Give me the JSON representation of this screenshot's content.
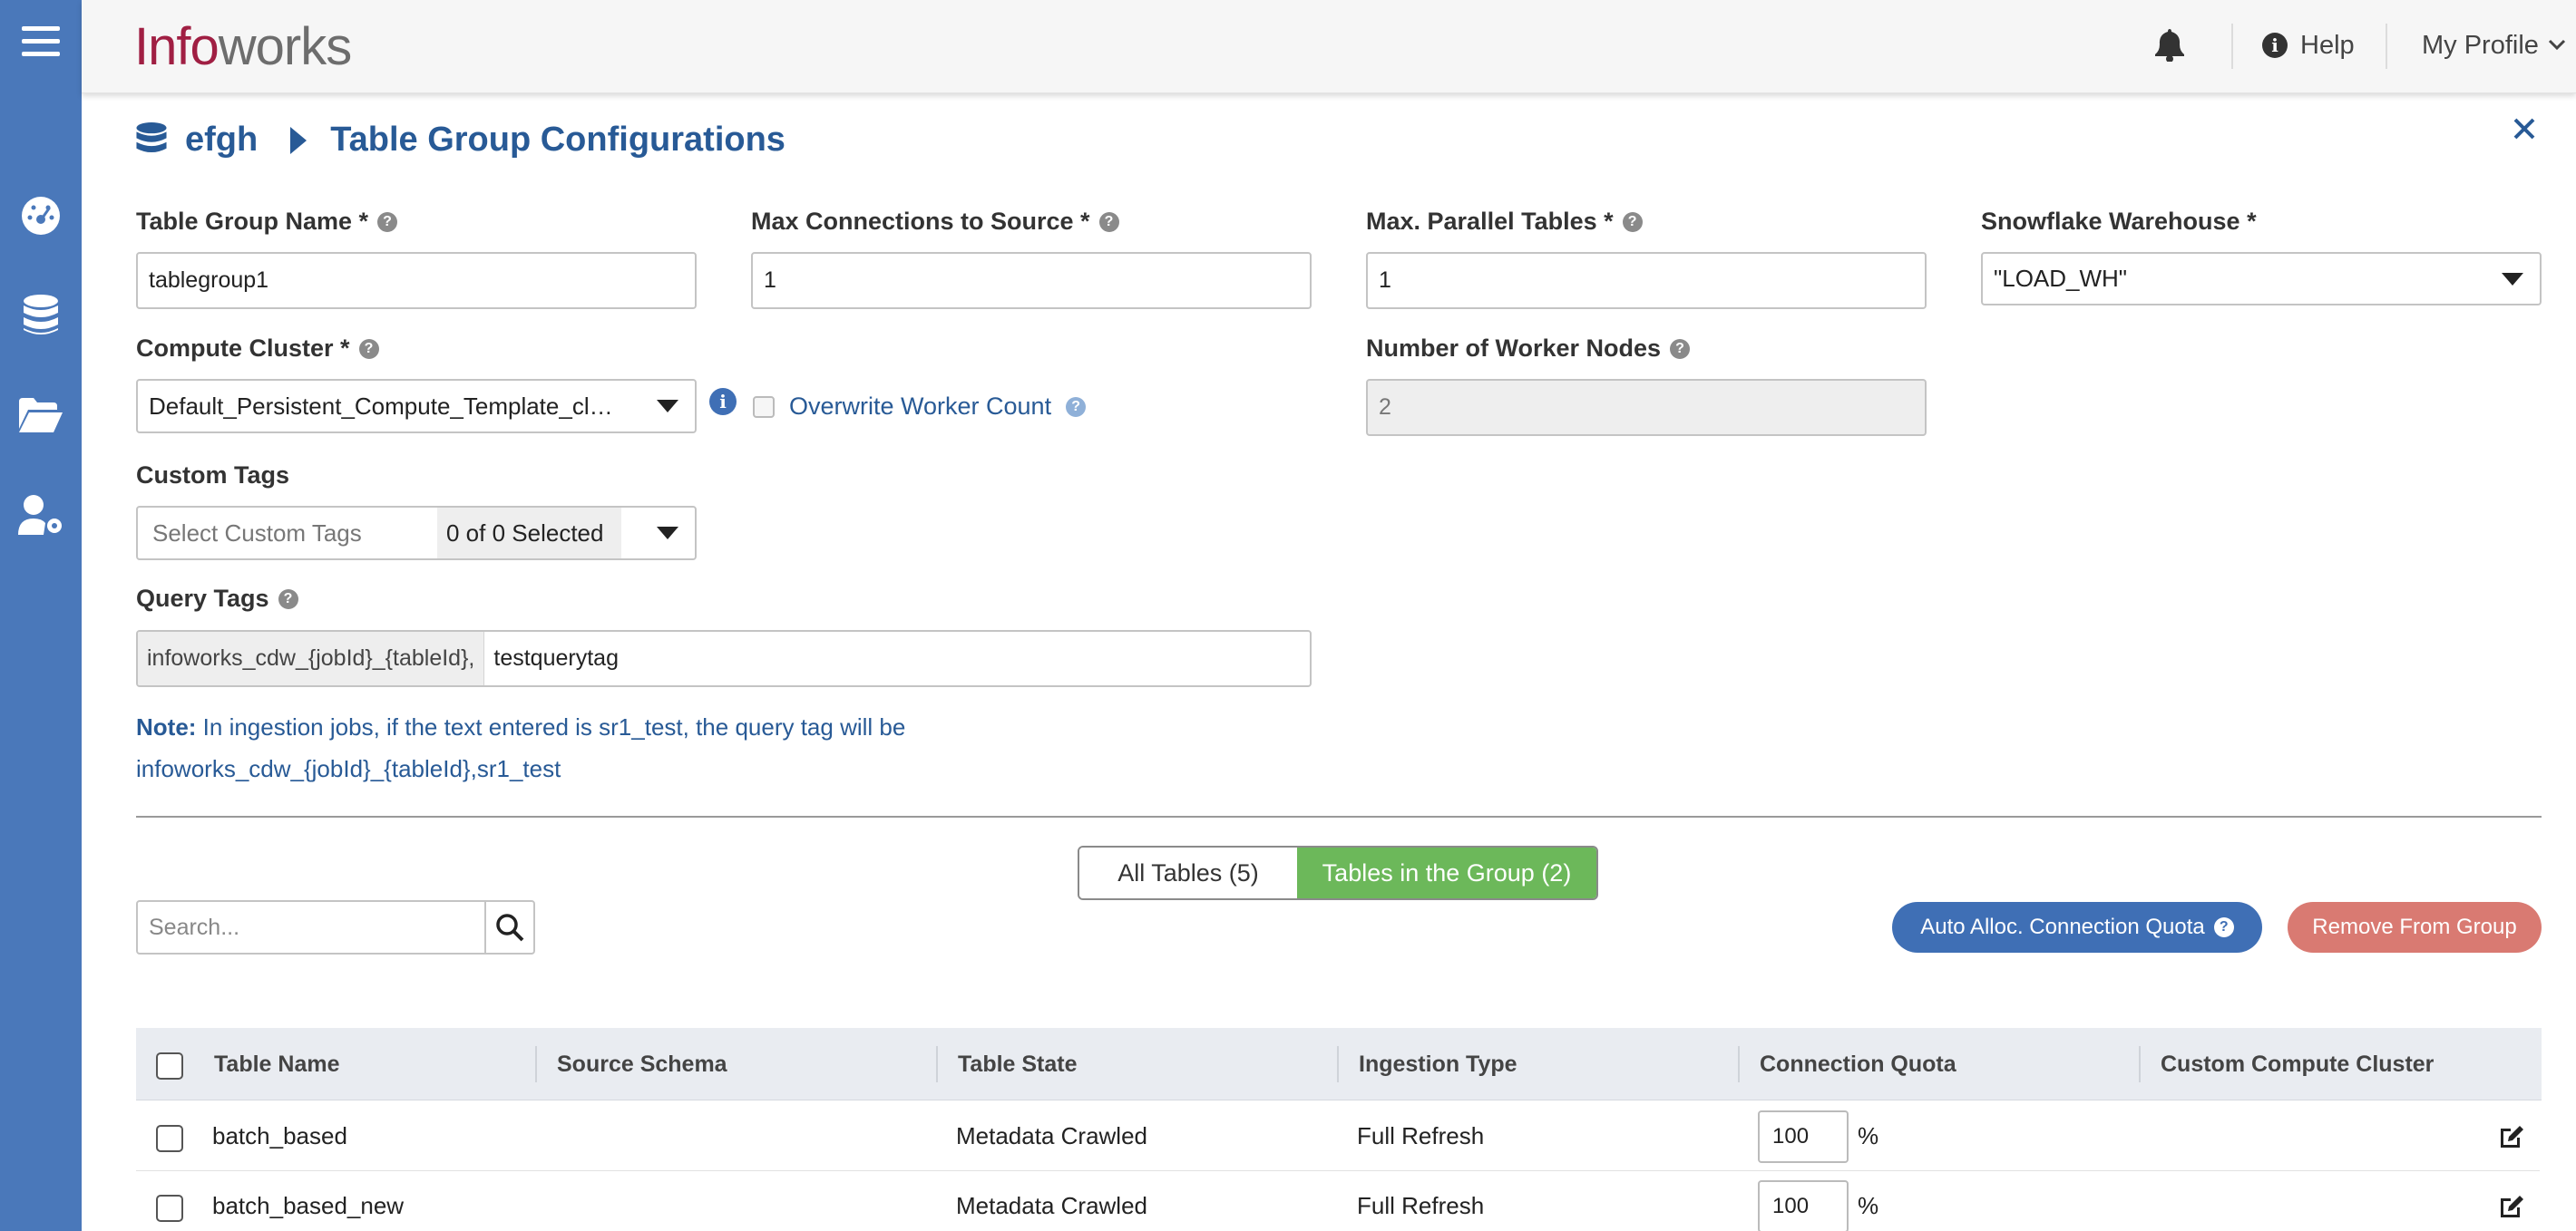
{
  "header": {
    "logo_part1": "Info",
    "logo_part2": "works",
    "help_label": "Help",
    "profile_label": "My Profile"
  },
  "breadcrumb": {
    "source": "efgh",
    "page_title": "Table Group Configurations"
  },
  "form": {
    "table_group_name": {
      "label": "Table Group Name *",
      "value": "tablegroup1"
    },
    "max_connections": {
      "label": "Max Connections to Source *",
      "value": "1"
    },
    "max_parallel": {
      "label": "Max. Parallel Tables *",
      "value": "1"
    },
    "warehouse": {
      "label": "Snowflake Warehouse *",
      "value": "\"LOAD_WH\""
    },
    "compute_cluster": {
      "label": "Compute Cluster *",
      "value": "Default_Persistent_Compute_Template_cl…"
    },
    "overwrite_worker": {
      "label": "Overwrite Worker Count"
    },
    "worker_nodes": {
      "label": "Number of Worker Nodes",
      "value": "2"
    },
    "custom_tags": {
      "label": "Custom Tags",
      "placeholder": "Select Custom Tags",
      "selected": "0 of 0 Selected"
    },
    "query_tags": {
      "label": "Query Tags",
      "prefix": "infoworks_cdw_{jobId}_{tableId},",
      "value": "testquerytag"
    },
    "note": {
      "bold": "Note:",
      "line1": " In ingestion jobs, if the text entered is sr1_test, the query tag will be",
      "line2": "infoworks_cdw_{jobId}_{tableId},sr1_test"
    }
  },
  "tabs": {
    "all_tables": "All Tables (5)",
    "tables_in_group": "Tables in the Group (2)"
  },
  "actions": {
    "search_placeholder": "Search...",
    "auto_alloc": "Auto Alloc. Connection Quota",
    "remove": "Remove From Group"
  },
  "table": {
    "columns": [
      "Table Name",
      "Source Schema",
      "Table State",
      "Ingestion Type",
      "Connection Quota",
      "Custom Compute Cluster"
    ],
    "rows": [
      {
        "name": "batch_based",
        "schema": "",
        "state": "Metadata Crawled",
        "ingestion": "Full Refresh",
        "quota": "100",
        "unit": "%"
      },
      {
        "name": "batch_based_new",
        "schema": "",
        "state": "Metadata Crawled",
        "ingestion": "Full Refresh",
        "quota": "100",
        "unit": "%"
      }
    ]
  },
  "colors": {
    "sidebar": "#4a78ba",
    "accent": "#285a96",
    "active_tab": "#6cb85a",
    "primary_button": "#3f6fb5",
    "danger_button": "#d97a72"
  }
}
